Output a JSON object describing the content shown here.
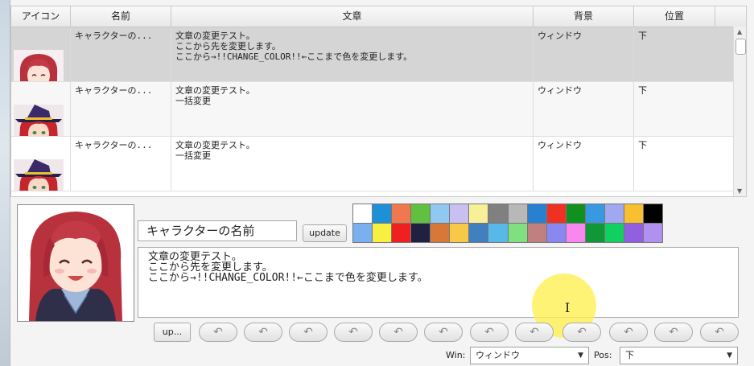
{
  "table": {
    "headers": [
      "アイコン",
      "名前",
      "文章",
      "背景",
      "位置"
    ],
    "rows": [
      {
        "name": "キャラクターの...",
        "text": "文章の変更テスト。\nここから先を変更します。\nここから→!!CHANGE_COLOR!!←ここまで色を変更します。",
        "background": "ウィンドウ",
        "position": "下",
        "icon": "smiling-girl-portrait"
      },
      {
        "name": "キャラクターの...",
        "text": "文章の変更テスト。\n一括変更",
        "background": "ウィンドウ",
        "position": "下",
        "icon": "witch-portrait"
      },
      {
        "name": "キャラクターの...",
        "text": "文章の変更テスト。\n一括変更",
        "background": "ウィンドウ",
        "position": "下",
        "icon": "witch-portrait"
      }
    ]
  },
  "editor": {
    "name_value": "キャラクターの名前",
    "update_label": "update",
    "message": "文章の変更テスト。\nここから先を変更します。\nここから→!!CHANGE_COLOR!!←ここまで色を変更します。",
    "up_label": "up...",
    "win_label": "Win:",
    "win_value": "ウィンドウ",
    "pos_label": "Pos:",
    "pos_value": "下"
  },
  "palette": [
    "#ffffff",
    "#1e90d8",
    "#f07850",
    "#60c040",
    "#90c8f0",
    "#c8c0f0",
    "#f8f098",
    "#808080",
    "#b8b8b8",
    "#2880d0",
    "#f03020",
    "#109020",
    "#3898e0",
    "#a0a8f0",
    "#f8c030",
    "#000000",
    "#78b0f0",
    "#f8f040",
    "#f02020",
    "#202040",
    "#d87838",
    "#f8c848",
    "#4080c0",
    "#58b8e8",
    "#80e080",
    "#c08080",
    "#8888f0",
    "#f888f0",
    "#109838",
    "#10d060",
    "#9060e0",
    "#b090f0"
  ]
}
